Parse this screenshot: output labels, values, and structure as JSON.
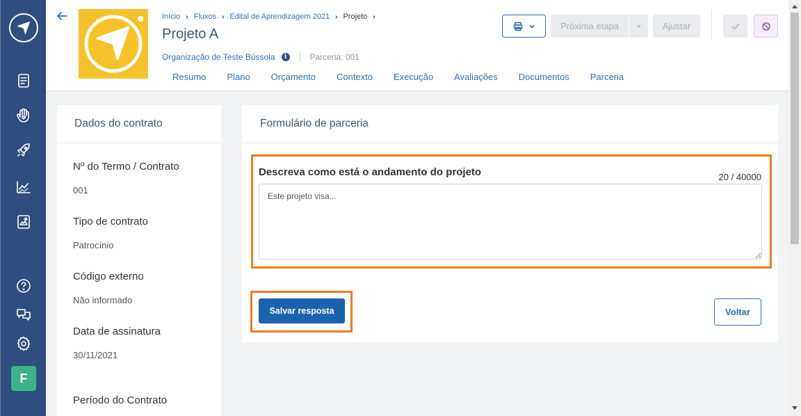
{
  "sidebar": {
    "items": [
      {
        "icon": "compass-logo-icon"
      },
      {
        "icon": "document-list-icon"
      },
      {
        "icon": "hand-heart-icon"
      },
      {
        "icon": "rocket-icon"
      },
      {
        "icon": "chart-line-icon"
      },
      {
        "icon": "image-book-icon"
      },
      {
        "icon": "help-icon"
      },
      {
        "icon": "chat-icon"
      },
      {
        "icon": "gear-icon"
      }
    ],
    "avatar_initial": "F"
  },
  "header": {
    "breadcrumb": [
      "Início",
      "Fluxos",
      "Edital de Aprendizagem 2021",
      "Projeto"
    ],
    "title": "Projeto A",
    "organization": "Organização de Teste Bússola",
    "info_glyph": "i",
    "parceria": "Parceria: 001",
    "tabs": [
      "Resumo",
      "Plano",
      "Orçamento",
      "Contexto",
      "Execução",
      "Avaliações",
      "Documentos",
      "Parceria"
    ],
    "next_step_label": "Próxima etapa",
    "adjust_label": "Ajustar"
  },
  "contract": {
    "title": "Dados do contrato",
    "fields": [
      {
        "label": "Nº do Termo / Contrato",
        "value": "001"
      },
      {
        "label": "Tipo de contrato",
        "value": "Patrocínio"
      },
      {
        "label": "Código externo",
        "value": "Não informado"
      },
      {
        "label": "Data de assinatura",
        "value": "30/11/2021"
      },
      {
        "label": "Período do Contrato",
        "value": ""
      }
    ]
  },
  "form": {
    "title": "Formulário de parceria",
    "question": "Descreva como está o andamento do projeto",
    "counter": "20 / 40000",
    "answer": "Este projeto visa...",
    "save_label": "Salvar resposta",
    "back_label": "Voltar"
  },
  "colors": {
    "sidebar": "#2d4e7e",
    "accent": "#1c63ad",
    "highlight": "#f47b20",
    "avatar": "#3db289",
    "logo_bg": "#f6c22a"
  }
}
